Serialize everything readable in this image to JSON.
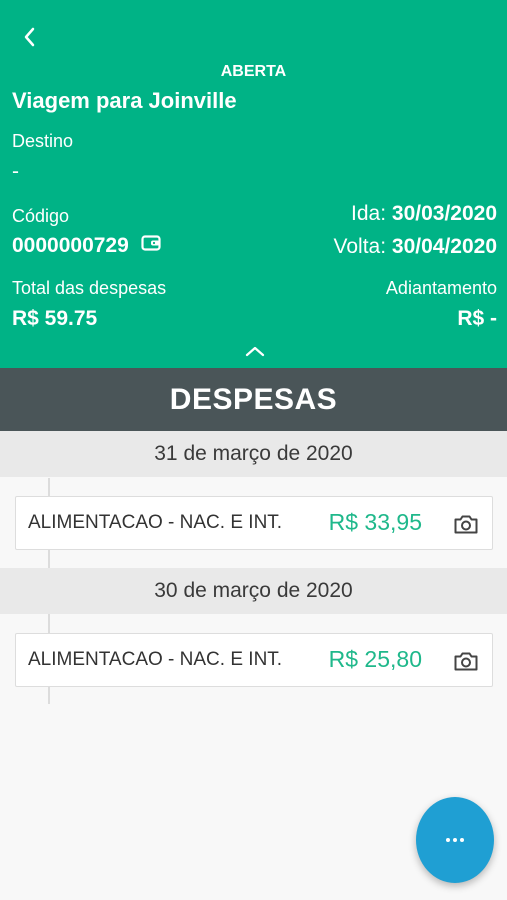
{
  "trip": {
    "status": "ABERTA",
    "title": "Viagem para Joinville",
    "destination_label": "Destino",
    "destination_value": "-",
    "code_label": "Código",
    "code_value": "0000000729",
    "departure_label": "Ida:",
    "departure_value": "30/03/2020",
    "return_label": "Volta:",
    "return_value": "30/04/2020",
    "total_label": "Total das despesas",
    "total_value": "R$ 59.75",
    "advance_label": "Adiantamento",
    "advance_value": "R$ -"
  },
  "section_title": "DESPESAS",
  "groups": [
    {
      "date": "31 de março de 2020",
      "expenses": [
        {
          "category": "ALIMENTACAO - NAC. E INT.",
          "amount": "R$ 33,95"
        }
      ]
    },
    {
      "date": "30 de março de 2020",
      "expenses": [
        {
          "category": "ALIMENTACAO - NAC. E INT.",
          "amount": "R$ 25,80"
        }
      ]
    }
  ],
  "colors": {
    "header": "#00b386",
    "section_bar": "#4a5558",
    "amount": "#1fb88b",
    "fab": "#1f9fd3"
  },
  "icons": [
    "back-arrow-icon",
    "wallet-icon",
    "chevron-up-icon",
    "camera-icon",
    "more-dots-icon"
  ]
}
